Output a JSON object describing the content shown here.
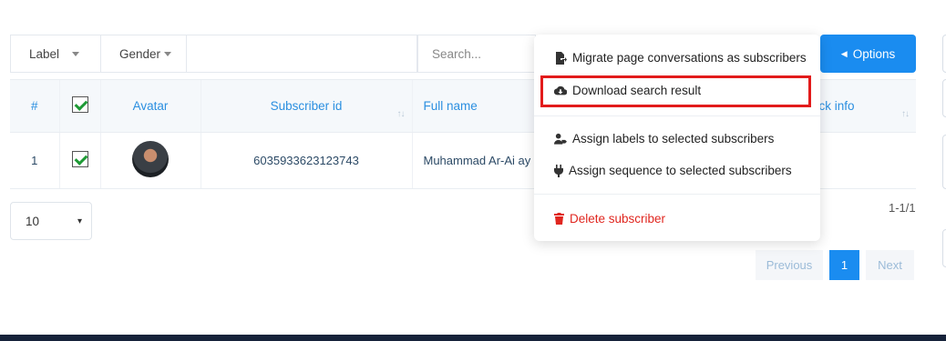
{
  "filters": {
    "label_select": "Label",
    "gender_select": "Gender",
    "search_placeholder": "Search..."
  },
  "options_button": "Options",
  "table": {
    "headers": {
      "index": "#",
      "avatar": "Avatar",
      "subscriber_id": "Subscriber id",
      "full_name": "Full name",
      "quick_info": "ick info"
    },
    "rows": [
      {
        "index": "1",
        "subscriber_id": "6035933623123743",
        "full_name": "Muhammad Ar-Ai ay"
      }
    ]
  },
  "page_size": "10",
  "record_count": "1-1/1",
  "pagination": {
    "previous": "Previous",
    "current": "1",
    "next": "Next"
  },
  "menu": {
    "migrate": "Migrate page conversations as subscribers",
    "download": "Download search result",
    "assign_labels": "Assign labels to selected subscribers",
    "assign_sequence": "Assign sequence to selected subscribers",
    "delete": "Delete subscriber"
  },
  "colors": {
    "accent": "#1a8cf0",
    "danger": "#e0261f",
    "highlight_box": "#e21b1b",
    "footer": "#16223a"
  }
}
